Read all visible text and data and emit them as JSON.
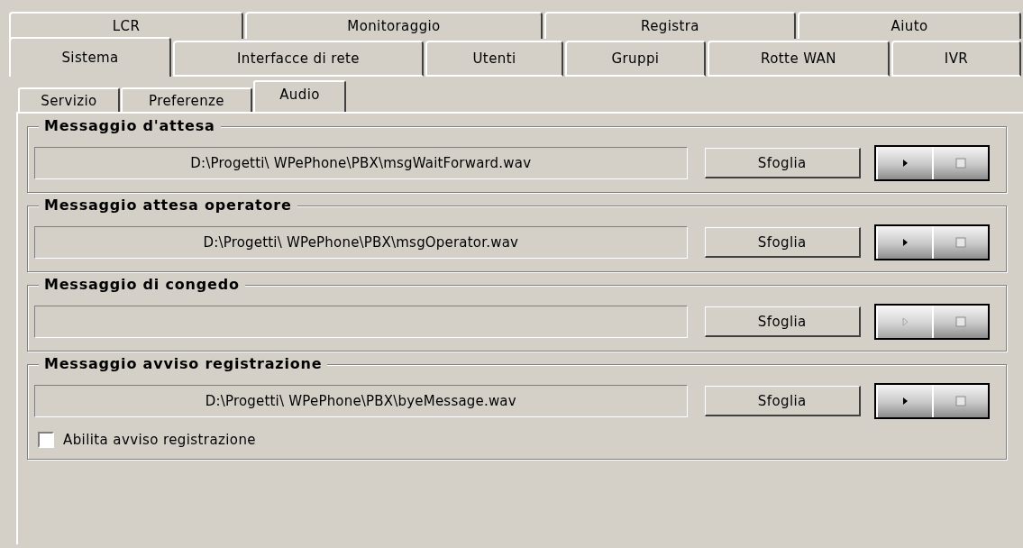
{
  "tab_rows": [
    [
      {
        "label": "LCR",
        "selected": false
      },
      {
        "label": "Monitoraggio",
        "selected": false
      },
      {
        "label": "Registra",
        "selected": false
      },
      {
        "label": "Aiuto",
        "selected": false
      }
    ],
    [
      {
        "label": "Sistema",
        "selected": true
      },
      {
        "label": "Interfacce di rete",
        "selected": false
      },
      {
        "label": "Utenti",
        "selected": false
      },
      {
        "label": "Gruppi",
        "selected": false
      },
      {
        "label": "Rotte WAN",
        "selected": false
      },
      {
        "label": "IVR",
        "selected": false
      }
    ]
  ],
  "subtabs": [
    {
      "label": "Servizio",
      "selected": false
    },
    {
      "label": "Preferenze",
      "selected": false
    },
    {
      "label": "Audio",
      "selected": true
    }
  ],
  "groups": [
    {
      "title": "Messaggio d'attesa",
      "file": "D:\\Progetti\\ WPePhone\\PBX\\msgWaitForward.wav",
      "browse_label": "Sfoglia",
      "play_disabled": false
    },
    {
      "title": "Messaggio attesa operatore",
      "file": "D:\\Progetti\\ WPePhone\\PBX\\msgOperator.wav",
      "browse_label": "Sfoglia",
      "play_disabled": false
    },
    {
      "title": "Messaggio di congedo",
      "browse_label": "Sfoglia",
      "play_disabled": true
    },
    {
      "title": "Messaggio avviso registrazione",
      "file": "D:\\Progetti\\ WPePhone\\PBX\\byeMessage.wav",
      "browse_label": "Sfoglia",
      "play_disabled": false,
      "checkbox": {
        "label": "Abilita avviso registrazione",
        "checked": false
      }
    }
  ]
}
